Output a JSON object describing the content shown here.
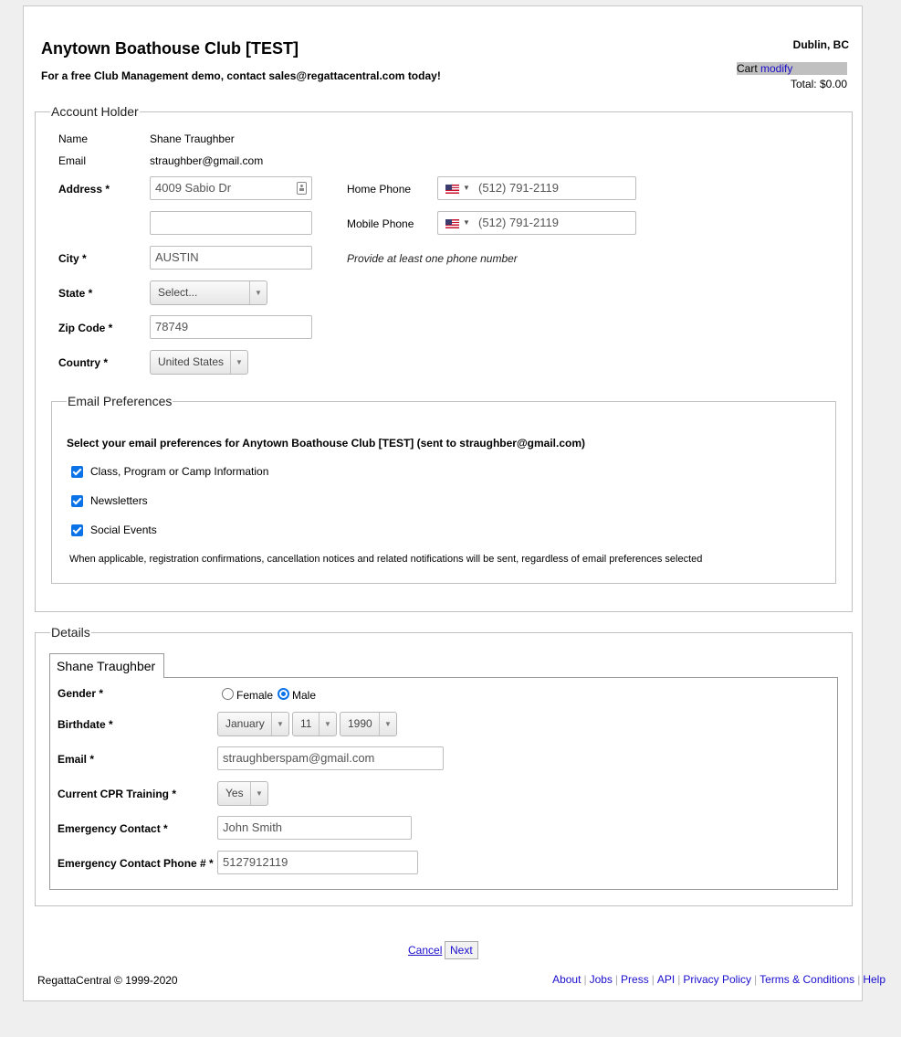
{
  "header": {
    "club_title": "Anytown Boathouse Club [TEST]",
    "promo": "For a free Club Management demo, contact sales@regattacentral.com today!",
    "location": "Dublin, BC",
    "cart_label": "Cart",
    "cart_modify": "modify",
    "total": "Total: $0.00"
  },
  "account_holder": {
    "legend": "Account Holder",
    "name_label": "Name",
    "name_value": "Shane Traughber",
    "email_label": "Email",
    "email_value": "straughber@gmail.com",
    "address_label": "Address *",
    "address1": "4009 Sabio Dr",
    "address2": "",
    "city_label": "City *",
    "city": "AUSTIN",
    "state_label": "State *",
    "state": "Select...",
    "zip_label": "Zip Code *",
    "zip": "78749",
    "country_label": "Country *",
    "country": "United States",
    "home_phone_label": "Home Phone",
    "home_phone": "(512) 791-2119",
    "mobile_phone_label": "Mobile Phone",
    "mobile_phone": "(512) 791-2119",
    "phone_hint": "Provide at least one phone number"
  },
  "email_prefs": {
    "legend": "Email Preferences",
    "intro": "Select your email preferences for Anytown Boathouse Club [TEST] (sent to straughber@gmail.com)",
    "options": [
      {
        "label": "Class, Program or Camp Information",
        "checked": true
      },
      {
        "label": "Newsletters",
        "checked": true
      },
      {
        "label": "Social Events",
        "checked": true
      }
    ],
    "notice": "When applicable, registration confirmations, cancellation notices and related notifications will be sent, regardless of email preferences selected"
  },
  "details": {
    "legend": "Details",
    "tab_label": "Shane Traughber",
    "gender_label": "Gender *",
    "female_label": "Female",
    "male_label": "Male",
    "gender_selected": "Male",
    "birthdate_label": "Birthdate *",
    "birth_month": "January",
    "birth_day": "11",
    "birth_year": "1990",
    "email_label": "Email *",
    "email": "straughberspam@gmail.com",
    "cpr_label": "Current CPR Training *",
    "cpr": "Yes",
    "emergency_contact_label": "Emergency Contact *",
    "emergency_contact": "John Smith",
    "emergency_phone_label": "Emergency Contact Phone # *",
    "emergency_phone": "5127912119"
  },
  "actions": {
    "cancel": "Cancel",
    "next": "Next"
  },
  "footer": {
    "copyright": "RegattaCentral © 1999-2020",
    "links": [
      "About",
      "Jobs",
      "Press",
      "API",
      "Privacy Policy",
      "Terms & Conditions",
      "Help"
    ]
  }
}
